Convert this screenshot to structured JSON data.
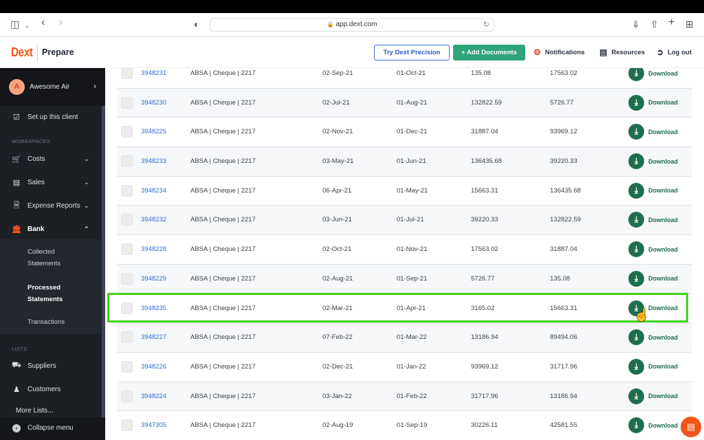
{
  "browser": {
    "url": "app.dext.com",
    "icons": [
      "sidebar-icon",
      "chevron-down-icon",
      "back-icon",
      "forward-icon",
      "shield-icon",
      "lock-icon",
      "reload-icon",
      "download-icon",
      "share-icon",
      "new-tab-icon",
      "tab-overview-icon"
    ]
  },
  "header": {
    "logo": "Dext",
    "product": "Prepare",
    "try_precision": "Try Dext Precision",
    "add_documents": "+ Add Documents",
    "notifications": "Notifications",
    "resources": "Resources",
    "logout": "Log out"
  },
  "sidebar": {
    "client": {
      "initial": "A",
      "name": "Awesome Air"
    },
    "setup": "Set up this client",
    "workspaces_label": "WORKSPACES",
    "workspaces": [
      {
        "label": "Costs",
        "icon": "cart-icon",
        "expanded": false
      },
      {
        "label": "Sales",
        "icon": "card-icon",
        "expanded": false
      },
      {
        "label": "Expense Reports",
        "icon": "receipt-icon",
        "expanded": false
      },
      {
        "label": "Bank",
        "icon": "bank-icon",
        "expanded": true
      }
    ],
    "bank_subitems": [
      {
        "label_1": "Collected",
        "label_2": "Statements",
        "active": false
      },
      {
        "label_1": "Processed",
        "label_2": "Statements",
        "active": true
      },
      {
        "label_1": "Transactions",
        "active": false
      }
    ],
    "lists_label": "LISTS",
    "lists": [
      {
        "label": "Suppliers",
        "icon": "truck-icon"
      },
      {
        "label": "Customers",
        "icon": "customers-icon"
      }
    ],
    "more_lists": "More Lists...",
    "collapse": "Collapse menu"
  },
  "table": {
    "download_label": "Download",
    "rows": [
      {
        "id": "3948231",
        "account": "ABSA | Cheque | 2217",
        "start": "02-Sep-21",
        "end": "01-Oct-21",
        "opening": "135.08",
        "closing": "17563.02"
      },
      {
        "id": "3948230",
        "account": "ABSA | Cheque | 2217",
        "start": "02-Jul-21",
        "end": "01-Aug-21",
        "opening": "132822.59",
        "closing": "5726.77"
      },
      {
        "id": "3948225",
        "account": "ABSA | Cheque | 2217",
        "start": "02-Nov-21",
        "end": "01-Dec-21",
        "opening": "31887.04",
        "closing": "93969.12"
      },
      {
        "id": "3948233",
        "account": "ABSA | Cheque | 2217",
        "start": "03-May-21",
        "end": "01-Jun-21",
        "opening": "136435.68",
        "closing": "39220.33"
      },
      {
        "id": "3948234",
        "account": "ABSA | Cheque | 2217",
        "start": "06-Apr-21",
        "end": "01-May-21",
        "opening": "15663.31",
        "closing": "136435.68"
      },
      {
        "id": "3948232",
        "account": "ABSA | Cheque | 2217",
        "start": "03-Jun-21",
        "end": "01-Jul-21",
        "opening": "39220.33",
        "closing": "132822.59"
      },
      {
        "id": "3948228",
        "account": "ABSA | Cheque | 2217",
        "start": "02-Oct-21",
        "end": "01-Nov-21",
        "opening": "17563.02",
        "closing": "31887.04"
      },
      {
        "id": "3948229",
        "account": "ABSA | Cheque | 2217",
        "start": "02-Aug-21",
        "end": "01-Sep-21",
        "opening": "5726.77",
        "closing": "135.08"
      },
      {
        "id": "3948235",
        "account": "ABSA | Cheque | 2217",
        "start": "02-Mar-21",
        "end": "01-Apr-21",
        "opening": "3165.02",
        "closing": "15663.31",
        "highlighted": true
      },
      {
        "id": "3948227",
        "account": "ABSA | Cheque | 2217",
        "start": "07-Feb-22",
        "end": "01-Mar-22",
        "opening": "13186.94",
        "closing": "89494.06"
      },
      {
        "id": "3948226",
        "account": "ABSA | Cheque | 2217",
        "start": "02-Dec-21",
        "end": "01-Jan-22",
        "opening": "93969.12",
        "closing": "31717.96"
      },
      {
        "id": "3948224",
        "account": "ABSA | Cheque | 2217",
        "start": "03-Jan-22",
        "end": "01-Feb-22",
        "opening": "31717.96",
        "closing": "13186.94"
      },
      {
        "id": "3947305",
        "account": "ABSA | Cheque | 2217",
        "start": "02-Aug-19",
        "end": "01-Sep-19",
        "opening": "30226.11",
        "closing": "42581.55"
      }
    ]
  },
  "colors": {
    "brand": "#f2541b",
    "primary_green": "#2fa37a",
    "download_green": "#1f6e4e",
    "link_blue": "#2f6bd1",
    "highlight": "#3fd51a"
  }
}
